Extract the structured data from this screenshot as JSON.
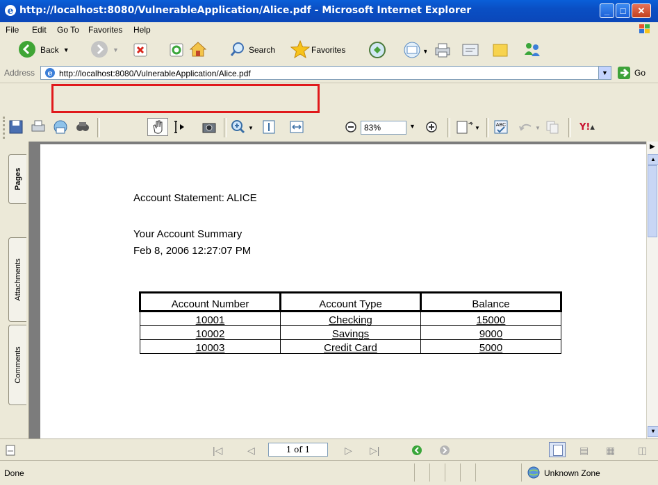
{
  "window": {
    "title": "http://localhost:8080/VulnerableApplication/Alice.pdf - Microsoft Internet Explorer"
  },
  "menu": [
    "File",
    "Edit",
    "Go To",
    "Favorites",
    "Help"
  ],
  "toolbar": {
    "back_label": "Back",
    "search_label": "Search",
    "favorites_label": "Favorites"
  },
  "address": {
    "label": "Address",
    "url": "http://localhost:8080/VulnerableApplication/Alice.pdf",
    "go_label": "Go"
  },
  "acrobat": {
    "zoom": "83%"
  },
  "nav_tabs": [
    "Pages",
    "Attachments",
    "Comments"
  ],
  "document": {
    "heading": "Account Statement: ALICE",
    "summary_title": "Your Account Summary",
    "timestamp": "Feb 8, 2006 12:27:07 PM",
    "table": {
      "headers": [
        "Account Number",
        "Account Type",
        "Balance"
      ],
      "rows": [
        [
          "10001",
          "Checking",
          "15000"
        ],
        [
          "10002",
          "Savings",
          "9000"
        ],
        [
          "10003",
          "Credit Card",
          "5000"
        ]
      ]
    }
  },
  "pagenav": {
    "page_indicator": "1 of 1"
  },
  "status": {
    "left": "Done",
    "zone": "Unknown Zone"
  },
  "colors": {
    "titlebar": "#0b4fc4",
    "highlight": "#e0191b",
    "chrome": "#ece9d8"
  }
}
